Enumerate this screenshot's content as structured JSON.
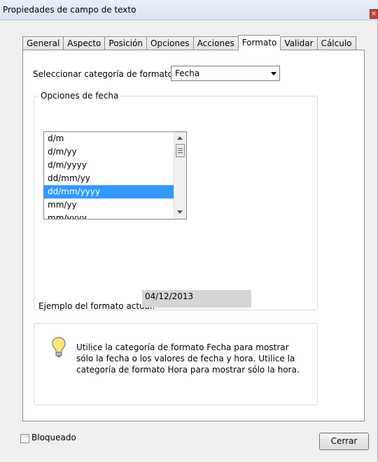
{
  "window": {
    "title": "Propiedades de campo de texto"
  },
  "tabs": [
    "General",
    "Aspecto",
    "Posición",
    "Opciones",
    "Acciones",
    "Formato",
    "Validar",
    "Cálculo"
  ],
  "active_tab": "Formato",
  "format": {
    "category_label": "Seleccionar categoría de formato:",
    "category_value": "Fecha"
  },
  "date_options": {
    "legend": "Opciones de fecha",
    "items": [
      "d/m",
      "d/m/yy",
      "d/m/yyyy",
      "dd/mm/yy",
      "dd/mm/yyyy",
      "mm/yy",
      "mm/yyyy"
    ],
    "selected": "dd/mm/yyyy",
    "example_label": "Ejemplo del formato actual:",
    "example_value": "04/12/2013"
  },
  "info": {
    "icon": "lightbulb-icon",
    "text": "Utilice la categoría de formato Fecha para mostrar sólo la fecha o los valores de fecha y hora. Utilice la categoría de formato Hora para mostrar sólo la hora."
  },
  "footer": {
    "locked_label": "Bloqueado",
    "close_label": "Cerrar"
  }
}
